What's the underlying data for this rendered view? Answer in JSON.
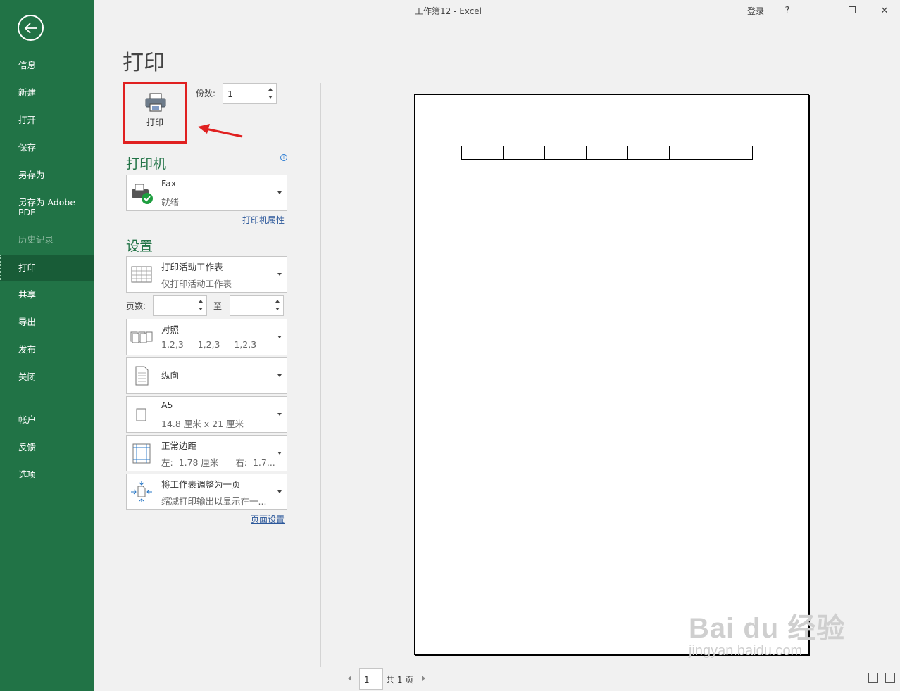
{
  "window": {
    "title": "工作簿12  -  Excel",
    "login": "登录",
    "help": "?",
    "minimize": "—",
    "restore": "❐",
    "close": "✕"
  },
  "sidebar": {
    "items": [
      {
        "label": "信息"
      },
      {
        "label": "新建"
      },
      {
        "label": "打开"
      },
      {
        "label": "保存"
      },
      {
        "label": "另存为"
      },
      {
        "label": "另存为 Adobe PDF"
      },
      {
        "label": "历史记录"
      },
      {
        "label": "打印"
      },
      {
        "label": "共享"
      },
      {
        "label": "导出"
      },
      {
        "label": "发布"
      },
      {
        "label": "关闭"
      },
      {
        "label": "帐户"
      },
      {
        "label": "反馈"
      },
      {
        "label": "选项"
      }
    ]
  },
  "print": {
    "heading": "打印",
    "button_label": "打印",
    "copies_label": "份数:",
    "copies_value": "1",
    "printer_section": "打印机",
    "printer_name": "Fax",
    "printer_status": "就绪",
    "printer_properties": "打印机属性",
    "settings_section": "设置",
    "what_main": "打印活动工作表",
    "what_sub": "仅打印活动工作表",
    "pages_label": "页数:",
    "pages_to": "至",
    "collate_main": "对照",
    "collate_sub": "1,2,3     1,2,3     1,2,3",
    "orientation_main": "纵向",
    "paper_main": "A5",
    "paper_sub": "14.8 厘米 x 21 厘米",
    "margins_main": "正常边距",
    "margins_sub": "左:  1.78 厘米      右:  1.7...",
    "scaling_main": "将工作表调整为一页",
    "scaling_sub": "缩减打印输出以显示在一...",
    "page_setup": "页面设置"
  },
  "preview": {
    "current_page": "1",
    "total": "共 1 页"
  },
  "watermark": {
    "line1": "Bai du 经验",
    "line2": "jingyan.baidu.com"
  },
  "colors": {
    "brand": "#217346",
    "highlight": "#e02020"
  }
}
